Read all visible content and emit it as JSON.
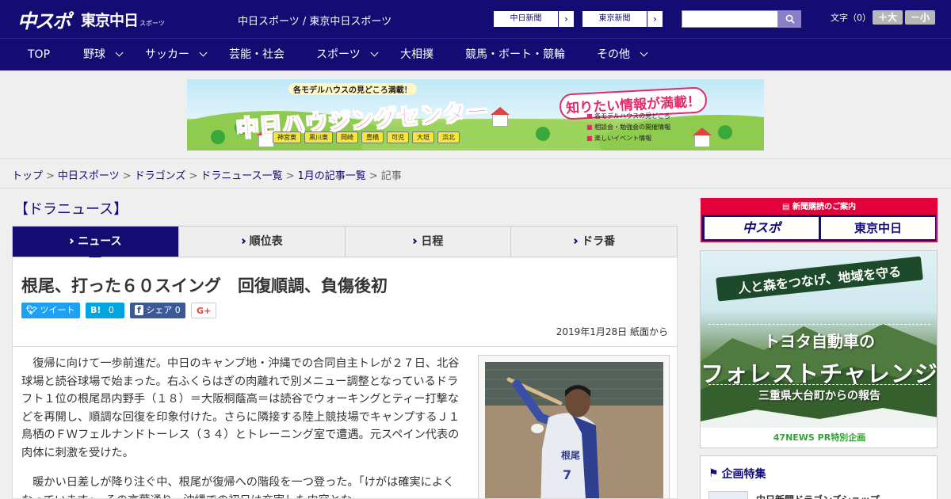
{
  "header": {
    "logo_main": "中スポ",
    "logo_tokyo": "東京中日",
    "logo_sports_small": "スポーツ",
    "site_names": "中日スポーツ / 東京中日スポーツ",
    "links": [
      {
        "label": "中日新聞"
      },
      {
        "label": "東京新聞"
      }
    ],
    "search": {
      "value": "",
      "placeholder": ""
    },
    "font_size": {
      "label": "文字（0）",
      "increase": "＋大",
      "decrease": "－小"
    }
  },
  "nav": {
    "items": [
      {
        "label": "TOP"
      },
      {
        "label": "野球"
      },
      {
        "label": "サッカー"
      },
      {
        "label": "芸能・社会"
      },
      {
        "label": "スポーツ"
      },
      {
        "label": "大相撲"
      },
      {
        "label": "競馬・ボート・競輪"
      },
      {
        "label": "その他"
      }
    ]
  },
  "banner": {
    "top_note": "各モデルハウスの見どころ満載！",
    "title": "中日ハウジングセンター",
    "catch": "知りたい情報が満載！",
    "bullets": [
      "各モデルハウスの見どころ",
      "相談会・勉強会の開催情報",
      "楽しいイベント情報"
    ],
    "places": [
      "神宮東",
      "黒川東",
      "岡崎",
      "豊橋",
      "可児",
      "大垣",
      "浜北"
    ]
  },
  "breadcrumb": {
    "items": [
      "トップ",
      "中日スポーツ",
      "ドラゴンズ",
      "ドラニュース一覧",
      "1月の記事一覧"
    ],
    "current": "記事"
  },
  "section_title": "【ドラニュース】",
  "tabs": [
    {
      "label": "ニュース"
    },
    {
      "label": "順位表"
    },
    {
      "label": "日程"
    },
    {
      "label": "ドラ番"
    }
  ],
  "article": {
    "headline": "根尾、打った６０スイング　回復順調、負傷後初",
    "share": {
      "tweet": "ツイート",
      "hatena": "B!",
      "hatena_count": "0",
      "facebook": "シェア",
      "facebook_count": "0",
      "gplus": "G+"
    },
    "pubdate": "2019年1月28日 紙面から",
    "paragraphs": [
      "復帰に向けて一歩前進だ。中日のキャンプ地・沖縄での合同自主トレが２７日、北谷球場と読谷球場で始まった。右ふくらはぎの肉離れで別メニュー調整となっているドラフト１位の根尾昂内野手（１８）＝大阪桐蔭高＝は読谷でウォーキングとティー打撃などを再開し、順調な回復を印象付けた。さらに隣接する陸上競技場でキャンプするＪ１鳥栖のＦＷフェルナンドトーレス（３４）とトレーニング室で遭遇。元スペイン代表の肉体に刺激を受けた。",
      "暖かい日差しが降り注ぐ中、根尾が復帰への階段を一つ登った。「けがは確実によくなっています」。その言葉通り、沖縄での初日は充実した内容とな"
    ],
    "photo_jersey_name": "根尾",
    "photo_jersey_number": "7"
  },
  "sidebar": {
    "subscription": {
      "header": "新聞購読のご案内",
      "logo_left": "中スポ",
      "logo_right": "東京中日"
    },
    "forest_ad": {
      "ribbon": "人と森をつなげ、地域を守る",
      "line1": "トヨタ自動車の",
      "line2": "フォレストチャレンジ",
      "line3": "三重県大台町からの報告",
      "footer": "47NEWS PR特別企画"
    },
    "features": {
      "title": "企画特集",
      "first_item": "中日新聞ドラゴンズショップ"
    }
  },
  "colors": {
    "brand_navy": "#140b73",
    "subscribe_red": "#e4003a",
    "twitter": "#1da1f2",
    "hatena": "#00a4de",
    "facebook": "#3b5998"
  }
}
